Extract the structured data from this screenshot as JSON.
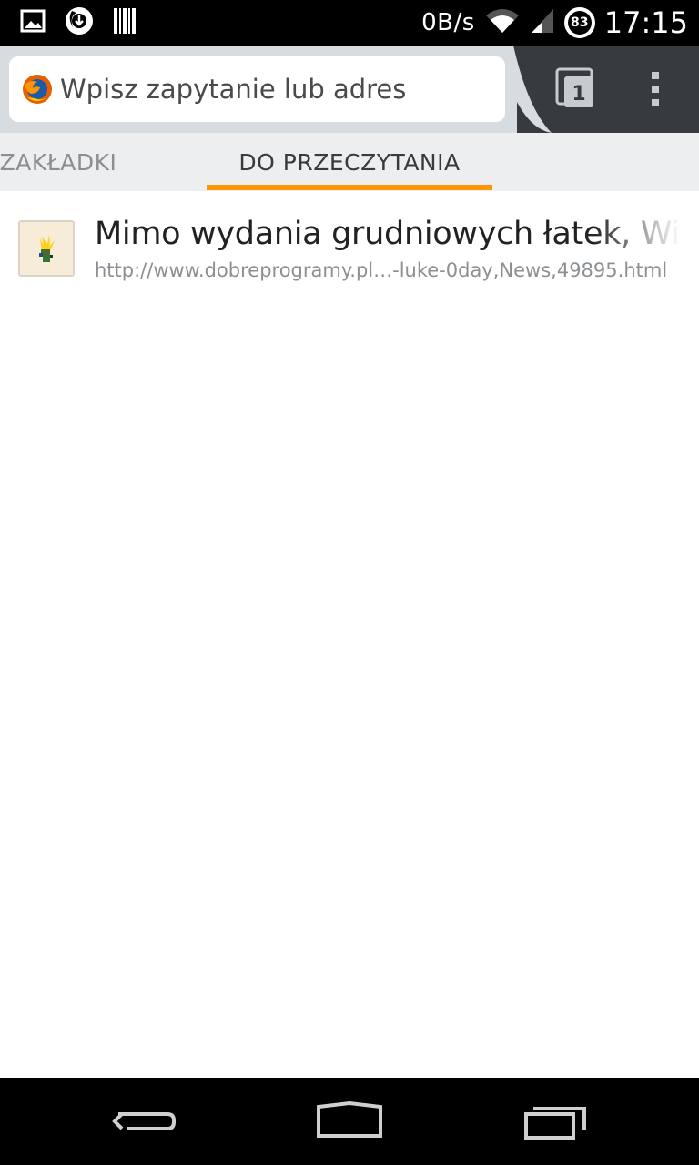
{
  "status_bar": {
    "network_speed": "0B/s",
    "battery_level": "83",
    "time": "17:15",
    "icons": [
      "image-icon",
      "firefox-download-icon",
      "barcode-icon",
      "wifi-icon",
      "cell-signal-icon",
      "battery-icon"
    ]
  },
  "toolbar": {
    "url_placeholder": "Wpisz zapytanie lub adres",
    "tab_count": "1"
  },
  "panel_tabs": [
    {
      "label": "ZAKŁADKI",
      "active": false
    },
    {
      "label": "DO PRZECZYTANIA",
      "active": true
    }
  ],
  "reading_list": [
    {
      "title": "Mimo wydania grudniowych łatek, Windo",
      "url": "http://www.dobreprogramy.pl…-luke-0day,News,49895.html"
    }
  ],
  "colors": {
    "accent": "#ff9500",
    "toolbar_bg": "#d7dce0",
    "toolbar_dark": "#373b3f",
    "tabs_bg": "#eceef0"
  }
}
